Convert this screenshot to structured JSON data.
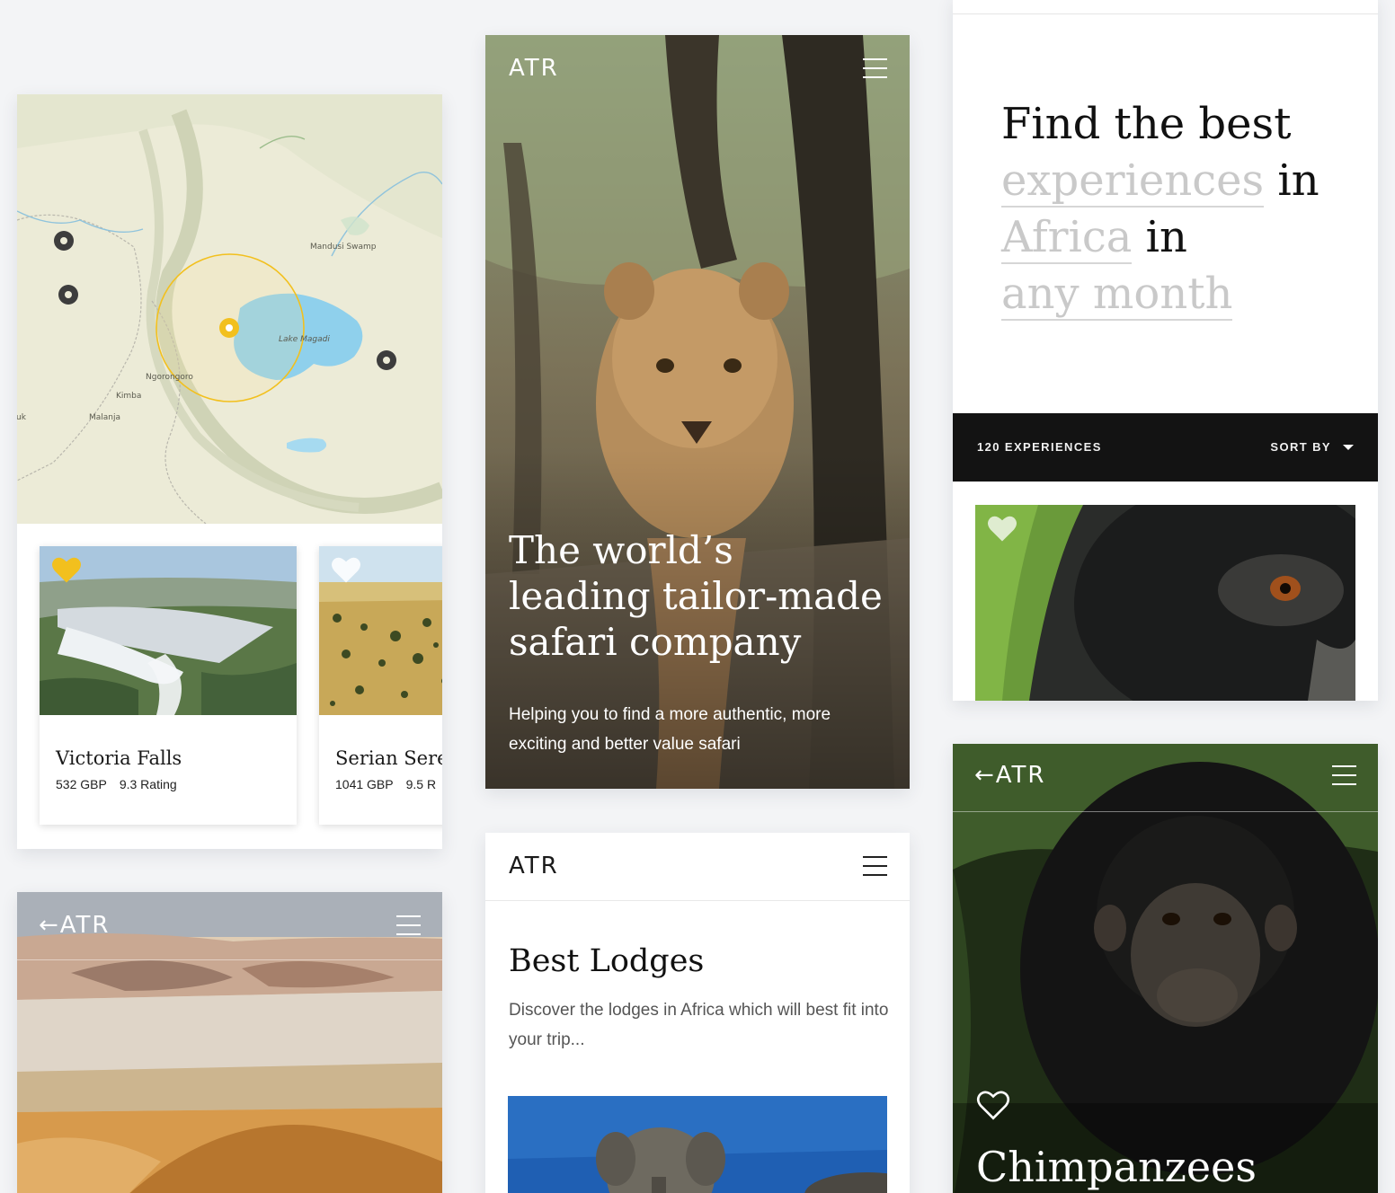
{
  "brand": {
    "logo": "ATR",
    "back_logo": "←ATR"
  },
  "map": {
    "labels": [
      "Mandusi Swamp",
      "Lake Magadi",
      "Ngorongoro",
      "Kimba",
      "Malanja",
      "uk"
    ],
    "colors": {
      "selected_pin": "#f2c01e",
      "pin": "#3d3d3d",
      "lake": "#8fd0ec"
    }
  },
  "cards": [
    {
      "name": "Victoria Falls",
      "price": "532 GBP",
      "rating": "9.3 Rating",
      "favorited": true
    },
    {
      "name": "Serian Seren",
      "price": "1041 GBP",
      "rating": "9.5 R",
      "favorited": false
    }
  ],
  "hero": {
    "title": "The world’s leading tailor-made safari company",
    "subtitle": "Helping you to find a more authentic, more exciting and better value safari"
  },
  "finder": {
    "line1": "Find the best",
    "option_experiences": "experiences",
    "in1": "in",
    "option_africa": "Africa",
    "in2": "in",
    "option_month": "any month",
    "count": "120 EXPERIENCES",
    "sort_label": "SORT BY"
  },
  "lodges": {
    "title": "Best Lodges",
    "description": "Discover the lodges in Africa which will best fit into your trip..."
  },
  "chimp": {
    "title": "Chimpanzees"
  },
  "icons": [
    "heart-icon",
    "menu-icon",
    "back-arrow-icon",
    "map-pin-icon",
    "caret-down-icon"
  ],
  "accent_color": "#f2c01e"
}
